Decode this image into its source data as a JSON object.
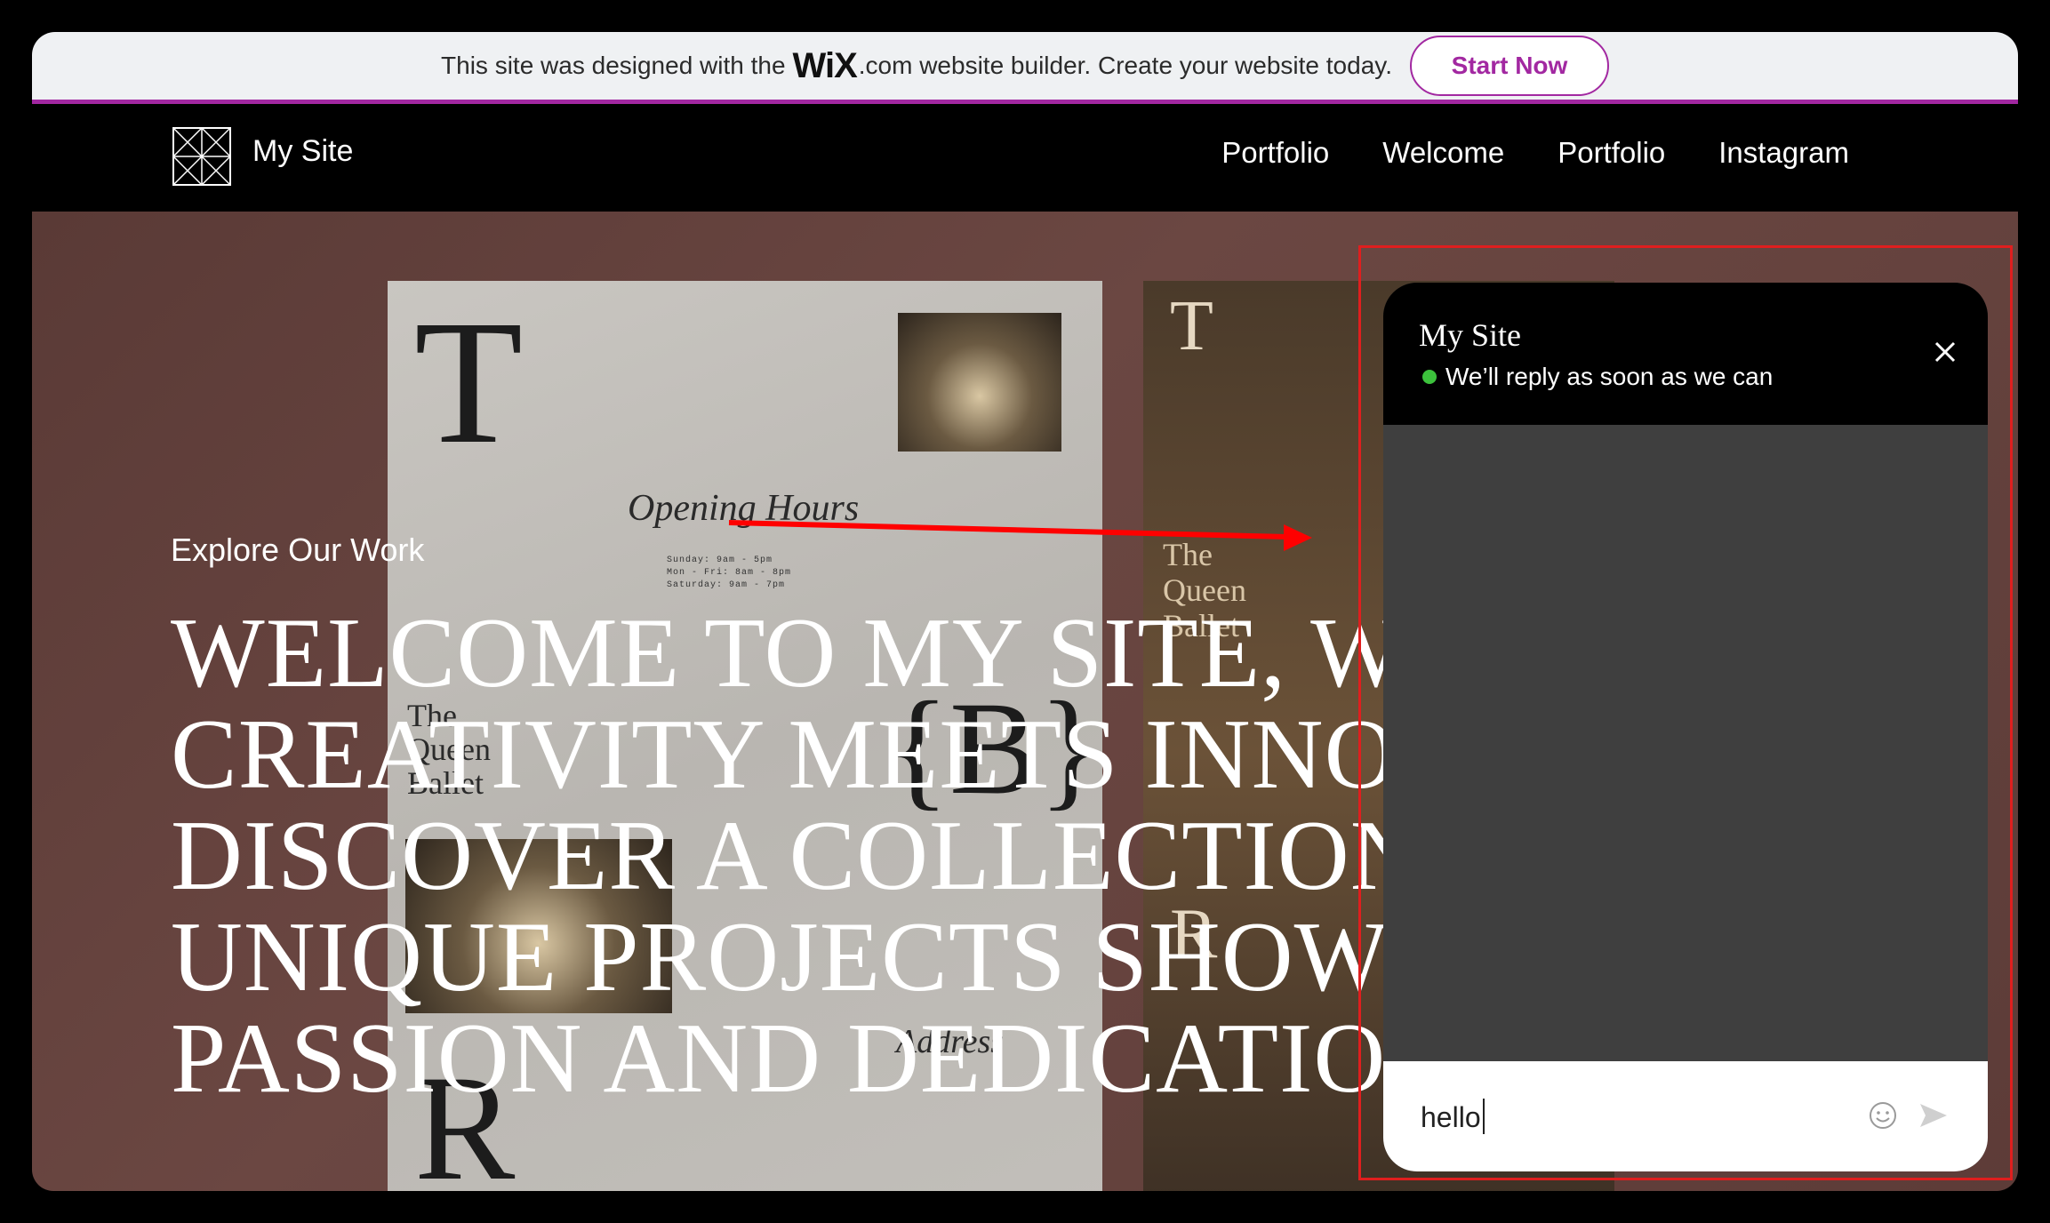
{
  "banner": {
    "text_before": "This site was designed with the",
    "brand": "WiX",
    "text_after": ".com website builder. Create your website today.",
    "cta": "Start Now",
    "accent": "#a228a1"
  },
  "header": {
    "site_name": "My Site",
    "logo_icon": "grid-logo-icon",
    "nav": [
      "Portfolio",
      "Welcome",
      "Portfolio",
      "Instagram"
    ]
  },
  "hero": {
    "eyebrow": "Explore Our Work",
    "headline": "WELCOME TO MY SITE, WHERE CREATIVITY MEETS INNOVATION. DISCOVER A COLLECTION OF UNIQUE PROJECTS SHOWCASING PASSION AND DEDICATION TO",
    "poster_left": {
      "letter_top": "T",
      "opening_hours": "Opening Hours",
      "hours_lines": [
        "Sunday: 9am - 5pm",
        "Mon - Fri: 8am - 8pm",
        "Saturday: 9am - 7pm"
      ],
      "brand_mark": "{B}",
      "the_queen_ballet": "The Queen Ballet",
      "address_label": "Address",
      "letter_bottom": "R"
    },
    "poster_right": {
      "letter_top": "T",
      "title": "The Queen Ballet",
      "letter_bottom": "R"
    }
  },
  "chat": {
    "title": "My Site",
    "status": "We’ll reply as soon as we can",
    "status_color": "#3cc13c",
    "input_value": "hello",
    "close_icon": "close-icon",
    "emoji_icon": "smiley-icon",
    "send_icon": "send-icon"
  }
}
